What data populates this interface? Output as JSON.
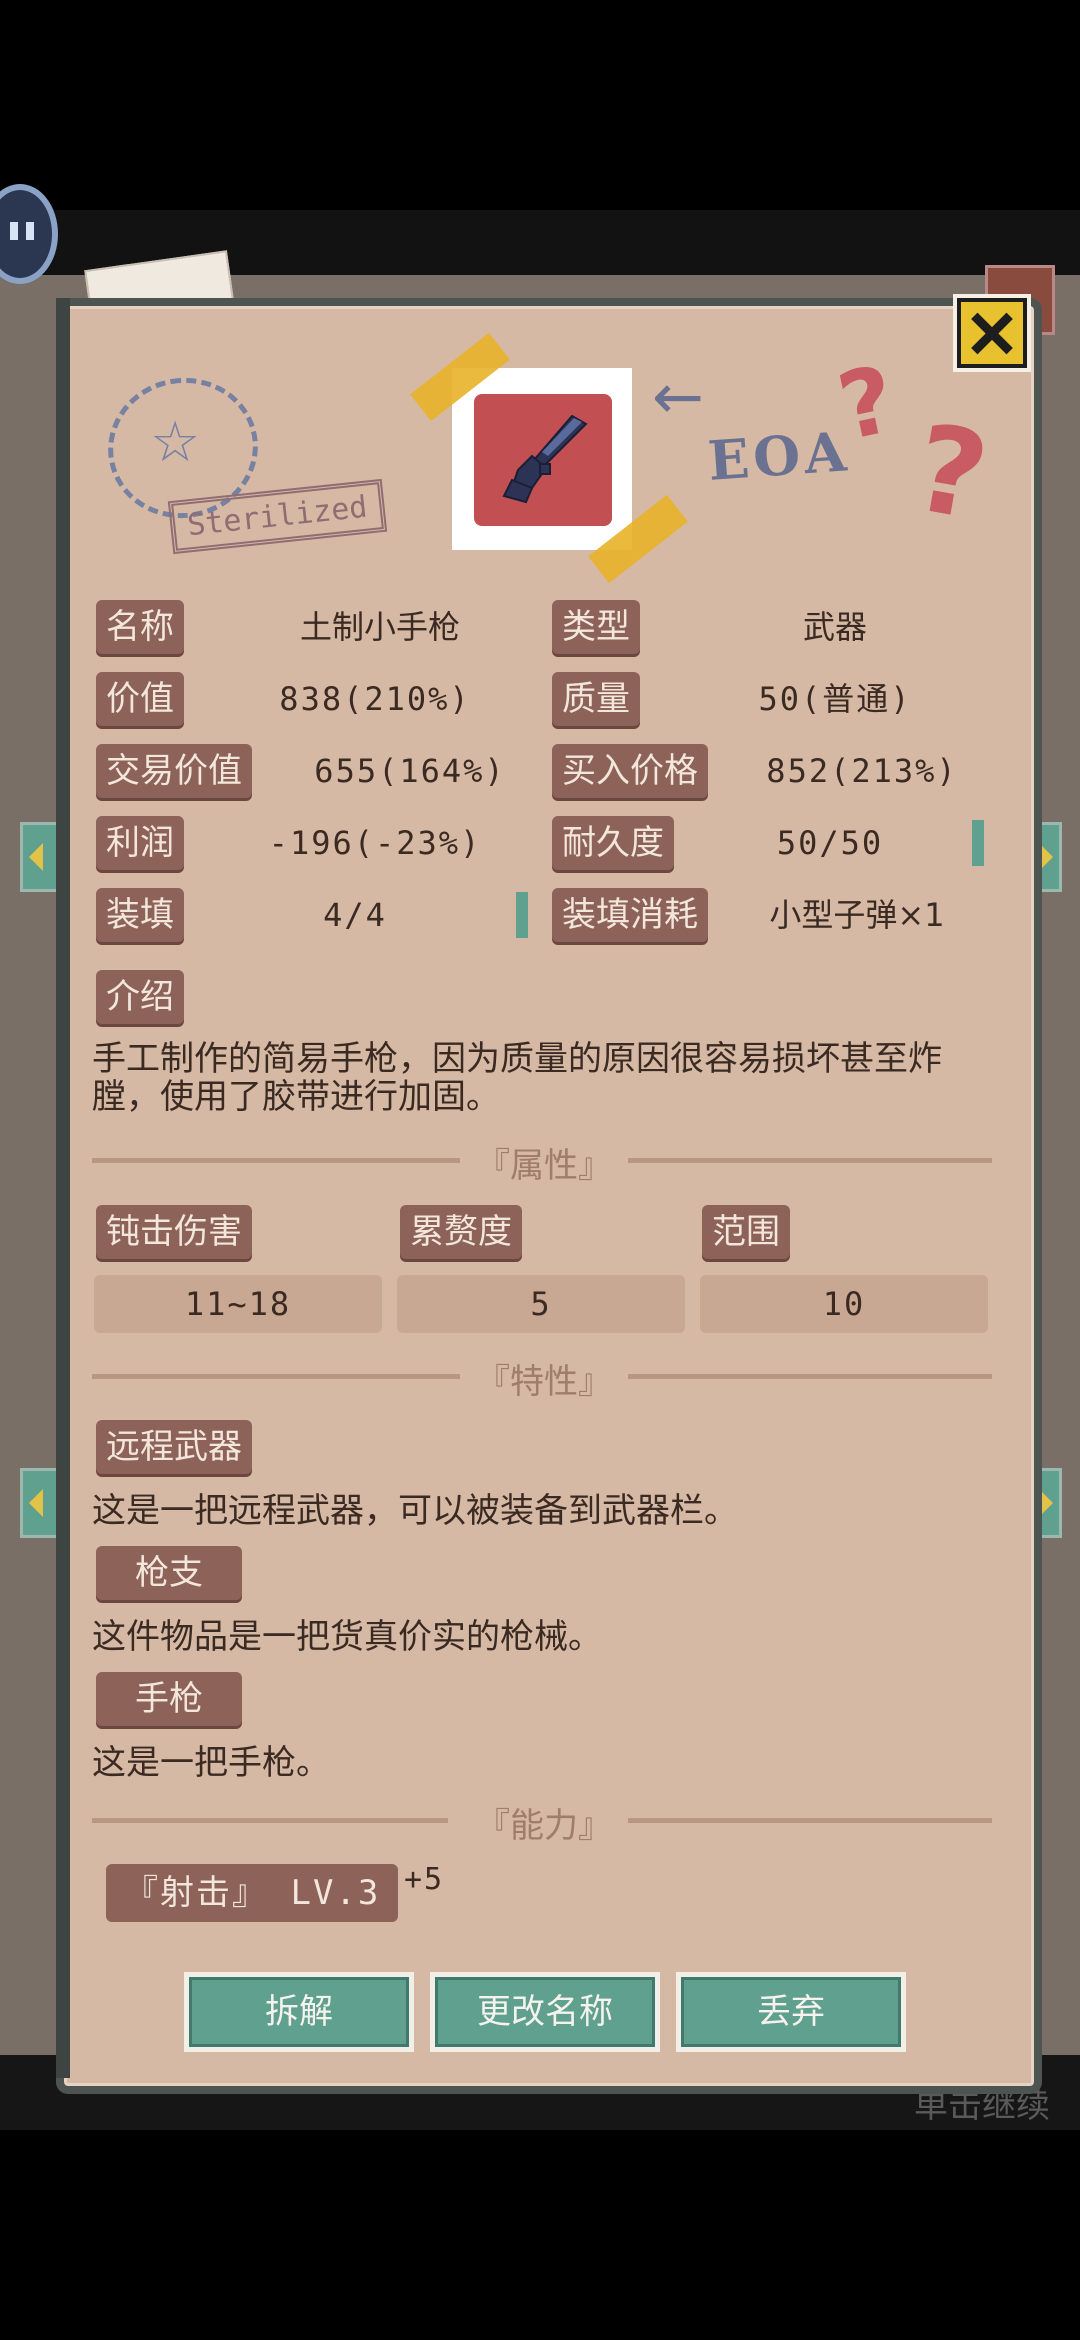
{
  "item": {
    "name_label": "名称",
    "name_value": "土制小手枪",
    "type_label": "类型",
    "type_value": "武器",
    "value_label": "价值",
    "value_value": "838(210%)",
    "quality_label": "质量",
    "quality_value": "50(普通)",
    "trade_label": "交易价值",
    "trade_value": "655(164%)",
    "buy_label": "买入价格",
    "buy_value": "852(213%)",
    "profit_label": "利润",
    "profit_value": "-196(-23%)",
    "durability_label": "耐久度",
    "durability_value": "50/50",
    "ammo_label": "装填",
    "ammo_value": "4/4",
    "ammo_cost_label": "装填消耗",
    "ammo_cost_value": "小型子弹×1",
    "intro_label": "介绍",
    "intro_text": "手工制作的简易手枪，因为质量的原因很容易损坏甚至炸膛，使用了胶带进行加固。"
  },
  "stamp": {
    "text": "Sterilized",
    "star": "☆"
  },
  "doodle": {
    "text": "EOA",
    "arrow": "←",
    "question": "?"
  },
  "attributes": {
    "title": "『属性』",
    "items": [
      {
        "label": "钝击伤害",
        "value": "11~18"
      },
      {
        "label": "累赘度",
        "value": "5"
      },
      {
        "label": "范围",
        "value": "10"
      }
    ]
  },
  "traits": {
    "title": "『特性』",
    "items": [
      {
        "label": "远程武器",
        "desc": "这是一把远程武器，可以被装备到武器栏。"
      },
      {
        "label": "枪支",
        "desc": "这件物品是一把货真价实的枪械。"
      },
      {
        "label": "手枪",
        "desc": "这是一把手枪。"
      }
    ]
  },
  "abilities": {
    "title": "『能力』",
    "items": [
      {
        "label": "『射击』 LV.3",
        "bonus": "+5"
      }
    ]
  },
  "actions": {
    "dismantle": "拆解",
    "rename": "更改名称",
    "discard": "丢弃"
  },
  "background": {
    "continue_hint": "单击继续"
  },
  "colors": {
    "accent": "#5fa08e",
    "tag": "#8c6259",
    "panel": "#d5b9a5",
    "close": "#e8c12e"
  },
  "icons": {
    "close": "close-icon",
    "item": "pistol-icon"
  }
}
